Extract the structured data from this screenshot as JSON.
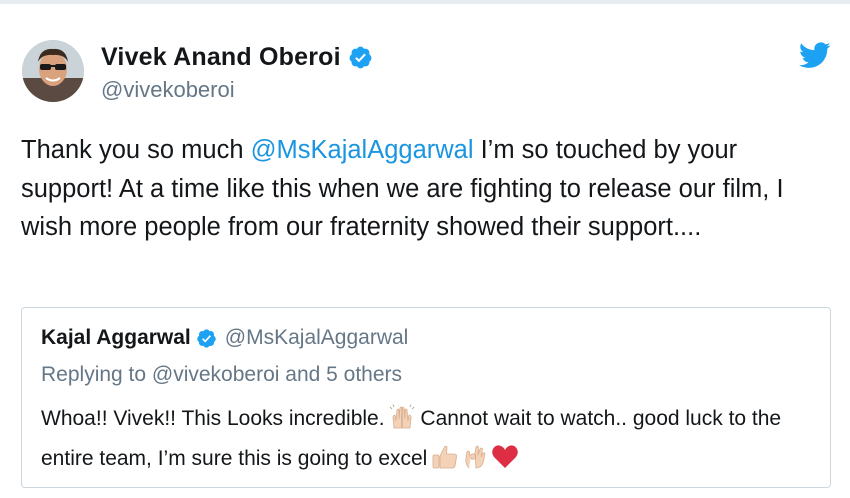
{
  "tweet": {
    "author_name": "Vivek Anand Oberoi",
    "author_handle": "@vivekoberoi",
    "text_before_mention": "Thank you so much ",
    "mention": "@MsKajalAggarwal",
    "text_after_mention": " I’m so touched by your support! At a time like this when we are fighting to release our film, I wish more people from our fraternity showed their support...."
  },
  "quoted_tweet": {
    "author_name": "Kajal Aggarwal",
    "author_handle": "@MsKajalAggarwal",
    "reply_context": "Replying to @vivekoberoi and 5 others",
    "text_part1": "Whoa!! Vivek!! This Looks incredible.",
    "text_part2": " Cannot wait to watch.. good luck to the entire team, I’m sure this is going to excel"
  },
  "icons": {
    "verified": "verified-badge-icon",
    "bird": "twitter-bird-icon",
    "raised_hands": "raising-hands-emoji",
    "thumbs_up": "thumbs-up-emoji",
    "ok_hand": "ok-hand-emoji",
    "heart": "red-heart-emoji"
  },
  "colors": {
    "brand_blue": "#1da1f2",
    "link_blue": "#1b95e0",
    "secondary_text": "#657786",
    "primary_text": "#14171a",
    "border": "#ccd6dd",
    "heart_red": "#dd2e44"
  }
}
